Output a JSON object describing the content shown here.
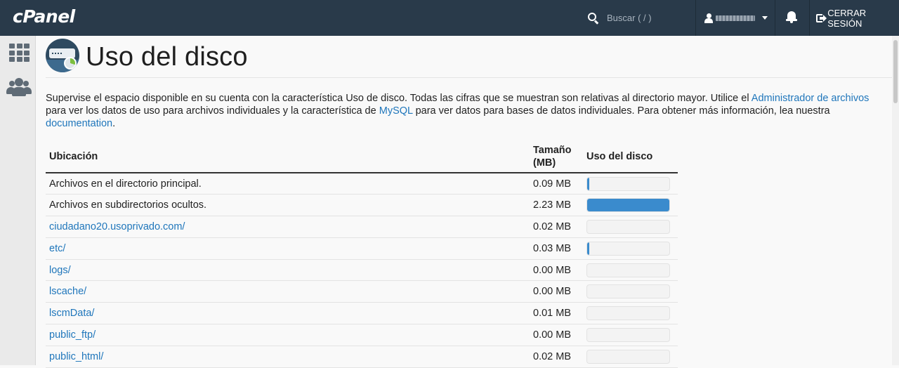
{
  "header": {
    "logo": "cPanel",
    "search_placeholder": "Buscar ( / )",
    "logout_label": "CERRAR SESIÓN"
  },
  "page": {
    "title": "Uso del disco",
    "intro_part1": "Supervise el espacio disponible en su cuenta con la característica Uso de disco. Todas las cifras que se muestran son relativas al directorio mayor. Utilice el ",
    "intro_link1": "Administrador de archivos",
    "intro_part2": " para ver los datos de uso para archivos individuales y la característica de ",
    "intro_link2": "MySQL",
    "intro_part3": " para ver datos para bases de datos individuales. Para obtener más información, lea nuestra ",
    "intro_link3": "documentation",
    "intro_part4": "."
  },
  "table": {
    "col_location": "Ubicación",
    "col_size_line1": "Tamaño",
    "col_size_line2": "(MB)",
    "col_usage": "Uso del disco",
    "rows": [
      {
        "location": "Archivos en el directorio principal.",
        "size": "0.09 MB",
        "usage": 0.02,
        "link": false
      },
      {
        "location": "Archivos en subdirectorios ocultos.",
        "size": "2.23 MB",
        "usage": 1.0,
        "link": false
      },
      {
        "location": "ciudadano20.usoprivado.com/",
        "size": "0.02 MB",
        "usage": 0.0,
        "link": true
      },
      {
        "location": "etc/",
        "size": "0.03 MB",
        "usage": 0.02,
        "link": true
      },
      {
        "location": "logs/",
        "size": "0.00 MB",
        "usage": 0.0,
        "link": true
      },
      {
        "location": "lscache/",
        "size": "0.00 MB",
        "usage": 0.0,
        "link": true
      },
      {
        "location": "lscmData/",
        "size": "0.01 MB",
        "usage": 0.0,
        "link": true
      },
      {
        "location": "public_ftp/",
        "size": "0.00 MB",
        "usage": 0.0,
        "link": true
      },
      {
        "location": "public_html/",
        "size": "0.02 MB",
        "usage": 0.0,
        "link": true
      }
    ]
  },
  "colors": {
    "topbar": "#293a4a",
    "link": "#1f76bb",
    "bar_fill": "#3a8bcd"
  }
}
